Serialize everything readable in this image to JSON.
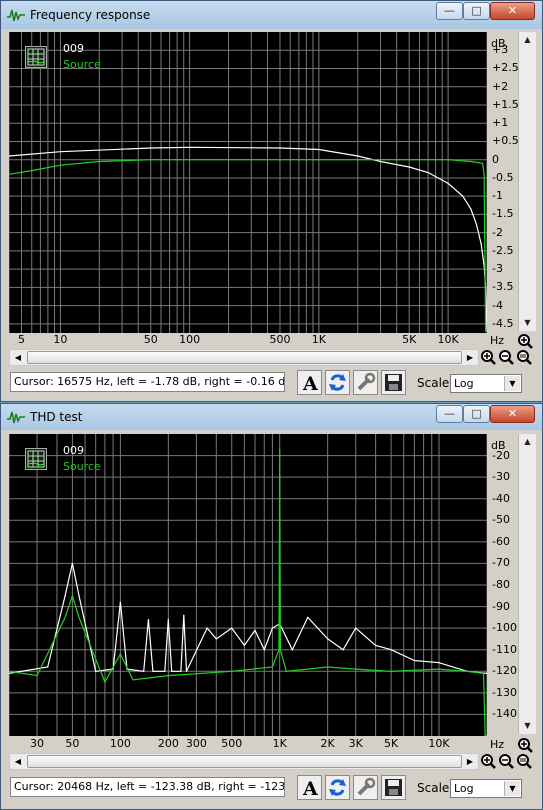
{
  "windows": [
    {
      "title": "Frequency response",
      "legend": {
        "name": "009",
        "source": "Source"
      },
      "y_unit": "dB",
      "x_unit": "Hz",
      "y_ticks": [
        "+3",
        "+2.5",
        "+2",
        "+1.5",
        "+1",
        "+0.5",
        "0",
        "-0.5",
        "-1",
        "-1.5",
        "-2",
        "-2.5",
        "-3",
        "-3.5",
        "-4",
        "-4.5"
      ],
      "x_ticks": [
        "5",
        "10",
        "50",
        "100",
        "500",
        "1K",
        "5K",
        "10K"
      ],
      "status": "Cursor:  16575 Hz,  left = -1.78 dB,  right = -0.16 dB",
      "scale_label": "Scale",
      "scale_value": "Log",
      "colors": {
        "series_white": "#ffffff",
        "series_green": "#21d221",
        "grid": "#7a7a7a",
        "background": "#000000"
      }
    },
    {
      "title": "THD test",
      "legend": {
        "name": "009",
        "source": "Source"
      },
      "y_unit": "dB",
      "x_unit": "Hz",
      "y_ticks": [
        "-20",
        "-30",
        "-40",
        "-50",
        "-60",
        "-70",
        "-80",
        "-90",
        "-100",
        "-110",
        "-120",
        "-130",
        "-140"
      ],
      "x_ticks": [
        "30",
        "50",
        "100",
        "200",
        "300",
        "500",
        "1K",
        "2K",
        "3K",
        "5K",
        "10K"
      ],
      "status": "Cursor:  20468 Hz,  left = -123.38 dB,  right = -123.91 dB",
      "scale_label": "Scale",
      "scale_value": "Log",
      "colors": {
        "series_white": "#ffffff",
        "series_green": "#21d221",
        "grid": "#7a7a7a",
        "background": "#000000"
      }
    }
  ],
  "chart_data": [
    {
      "type": "line",
      "title": "Frequency response",
      "xlabel": "Hz",
      "ylabel": "dB",
      "x_scale": "log",
      "xlim": [
        4,
        20000
      ],
      "ylim": [
        -4.75,
        3.5
      ],
      "grid": true,
      "legend_position": "top-left",
      "series": [
        {
          "name": "009",
          "x": [
            4,
            10,
            50,
            100,
            500,
            1000,
            2000,
            3000,
            5000,
            7000,
            10000,
            13000,
            15000,
            16575,
            18000,
            19000,
            19500,
            20000
          ],
          "y": [
            0.1,
            0.22,
            0.32,
            0.34,
            0.32,
            0.28,
            0.1,
            -0.05,
            -0.2,
            -0.35,
            -0.65,
            -1.0,
            -1.35,
            -1.78,
            -2.3,
            -2.9,
            -3.5,
            -4.7
          ]
        },
        {
          "name": "Source",
          "x": [
            4,
            6,
            10,
            20,
            50,
            100,
            500,
            1000,
            5000,
            10000,
            15000,
            18500,
            19000,
            19500,
            20000
          ],
          "y": [
            -0.4,
            -0.3,
            -0.15,
            -0.05,
            0,
            0,
            0,
            0,
            0,
            0,
            -0.05,
            -0.1,
            -0.4,
            -4.7,
            -4.7
          ]
        }
      ]
    },
    {
      "type": "line",
      "title": "THD test",
      "xlabel": "Hz",
      "ylabel": "dB",
      "x_scale": "log",
      "xlim": [
        20,
        20000
      ],
      "ylim": [
        -150,
        -10
      ],
      "grid": true,
      "legend_position": "top-left",
      "series": [
        {
          "name": "009",
          "x": [
            20,
            35,
            45,
            50,
            55,
            70,
            90,
            100,
            110,
            140,
            150,
            160,
            190,
            200,
            210,
            240,
            250,
            260,
            350,
            400,
            500,
            600,
            700,
            800,
            900,
            1000,
            1200,
            1500,
            2000,
            2500,
            3000,
            4000,
            5000,
            7000,
            10000,
            15000,
            20000
          ],
          "y": [
            -121,
            -118,
            -85,
            -70,
            -85,
            -120,
            -119,
            -88,
            -119,
            -120,
            -96,
            -120,
            -120,
            -96,
            -120,
            -120,
            -94,
            -120,
            -100,
            -105,
            -100,
            -108,
            -101,
            -110,
            -100,
            -98,
            -110,
            -95,
            -105,
            -110,
            -100,
            -108,
            -110,
            -115,
            -116,
            -120,
            -121
          ]
        },
        {
          "name": "Source",
          "x": [
            20,
            30,
            45,
            50,
            55,
            80,
            100,
            120,
            200,
            500,
            900,
            990,
            1000,
            1010,
            1100,
            2000,
            3000,
            5000,
            10000,
            15000,
            19000,
            19500,
            20000
          ],
          "y": [
            -120,
            -122,
            -95,
            -85,
            -95,
            -125,
            -112,
            -124,
            -122,
            -120,
            -118,
            -110,
            -17,
            -110,
            -120,
            -118,
            -119,
            -120,
            -119,
            -120,
            -121,
            -150,
            -150
          ]
        }
      ]
    }
  ]
}
